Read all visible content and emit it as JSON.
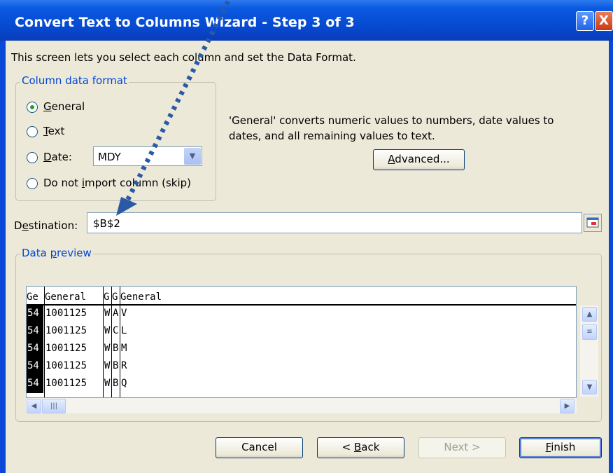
{
  "window": {
    "title": "Convert Text to Columns Wizard - Step 3 of 3",
    "help_icon": "?",
    "close_icon": "X"
  },
  "intro": "This screen lets you select each column and set the Data Format.",
  "format_group": {
    "label": "Column data format",
    "options": [
      {
        "key": "G",
        "rest": "eneral",
        "pre": "",
        "selected": true
      },
      {
        "key": "T",
        "rest": "ext",
        "pre": "",
        "selected": false
      },
      {
        "key": "D",
        "rest": "ate:",
        "pre": "",
        "selected": false
      },
      {
        "key": "i",
        "pre": "Do not ",
        "rest": "mport column (skip)",
        "selected": false
      }
    ],
    "date_format": "MDY"
  },
  "description": "'General' converts numeric values to numbers, date values to dates, and all remaining values to text.",
  "advanced_button": {
    "key": "A",
    "rest": "dvanced..."
  },
  "destination": {
    "pre": "D",
    "key": "e",
    "rest": "stination:",
    "value": "$B$2"
  },
  "preview": {
    "label_pre": "Data ",
    "label_key": "p",
    "label_rest": "review",
    "headers": [
      "Ge",
      "General",
      "G",
      "G",
      "General"
    ],
    "rows": [
      [
        "54",
        "1001125",
        "W",
        "A",
        "V"
      ],
      [
        "54",
        "1001125",
        "W",
        "C",
        "L"
      ],
      [
        "54",
        "1001125",
        "W",
        "B",
        "M"
      ],
      [
        "54",
        "1001125",
        "W",
        "B",
        "R"
      ],
      [
        "54",
        "1001125",
        "W",
        "B",
        "Q"
      ]
    ]
  },
  "buttons": {
    "cancel": "Cancel",
    "back_pre": "< ",
    "back_key": "B",
    "back_rest": "ack",
    "next": "Next >",
    "finish_key": "F",
    "finish_rest": "inish"
  },
  "colors": {
    "title_bar": "#0a54e0",
    "dialog_bg": "#ece9d8",
    "group_label": "#0046d5",
    "annotation_arrow": "#2a5aa6"
  }
}
